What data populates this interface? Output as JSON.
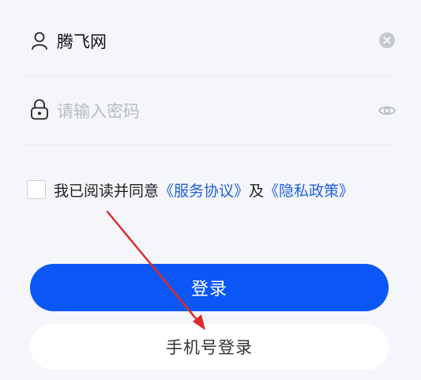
{
  "username_field": {
    "value": "腾飞网",
    "icon": "user-icon",
    "clear_icon": "clear-icon"
  },
  "password_field": {
    "placeholder": "请输入密码",
    "icon": "lock-icon",
    "toggle_icon": "eye-icon"
  },
  "agreement": {
    "checked": false,
    "prefix": "我已阅读并同意",
    "service_link": "《服务协议》",
    "conjunction": "及",
    "privacy_link": "《隐私政策》"
  },
  "buttons": {
    "login": "登录",
    "phone_login": "手机号登录"
  },
  "colors": {
    "primary": "#0b57f5",
    "link": "#1f5fe0",
    "annotation_arrow": "#e02a2a"
  }
}
